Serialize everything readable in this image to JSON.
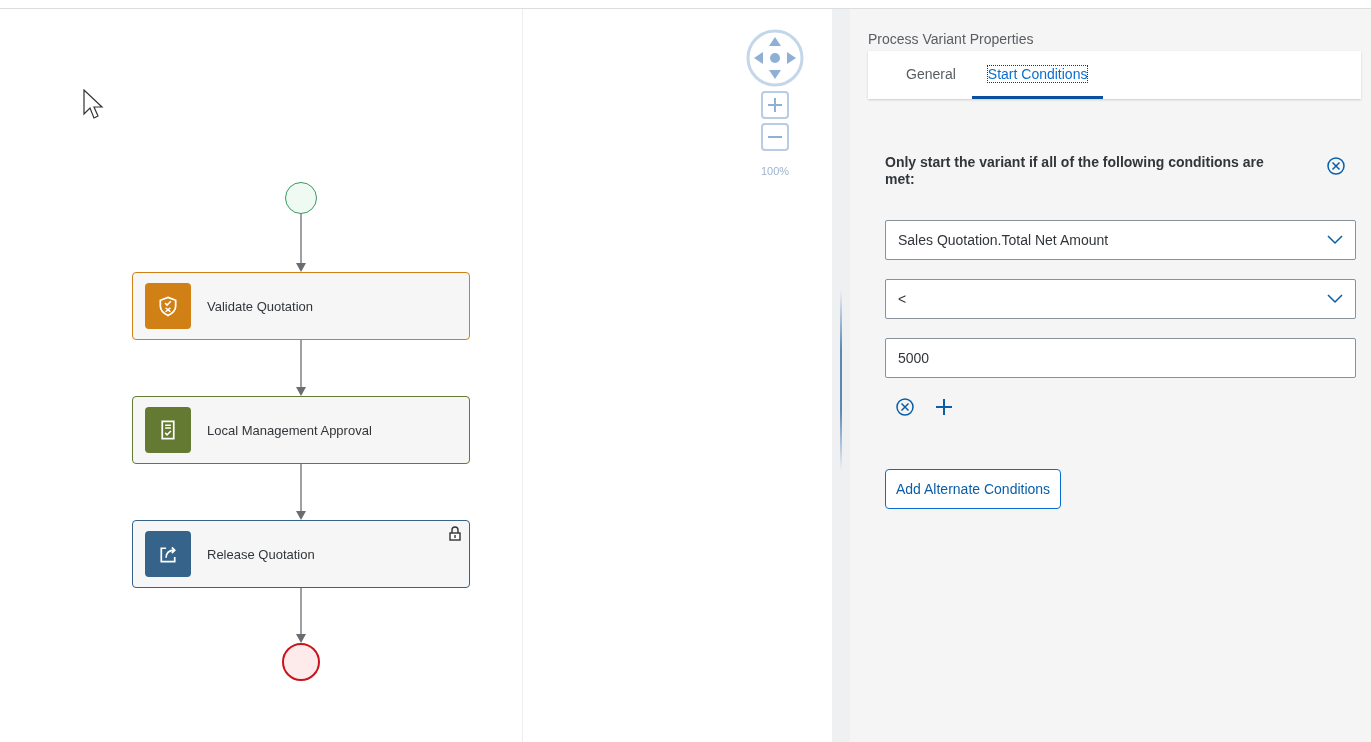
{
  "diagram": {
    "tasks": [
      {
        "label": "Validate Quotation",
        "color": "#d08014",
        "kind": "shield",
        "locked": false
      },
      {
        "label": "Local Management Approval",
        "color": "#647a32",
        "kind": "document",
        "locked": false
      },
      {
        "label": "Release Quotation",
        "color": "#356389",
        "kind": "share",
        "locked": true
      }
    ]
  },
  "zoom": {
    "reading": "100%"
  },
  "panel": {
    "title": "Process Variant Properties",
    "tabs": [
      {
        "label": "General",
        "selected": false
      },
      {
        "label": "Start Conditions",
        "selected": true
      }
    ],
    "condition_text": "Only start the variant if all of the following conditions are met:",
    "fields": [
      {
        "kind": "dropdown",
        "value": "Sales Quotation.Total Net Amount"
      },
      {
        "kind": "dropdown",
        "value": "<"
      },
      {
        "kind": "input",
        "value": "5000"
      }
    ],
    "add_button": "Add Alternate Conditions"
  }
}
